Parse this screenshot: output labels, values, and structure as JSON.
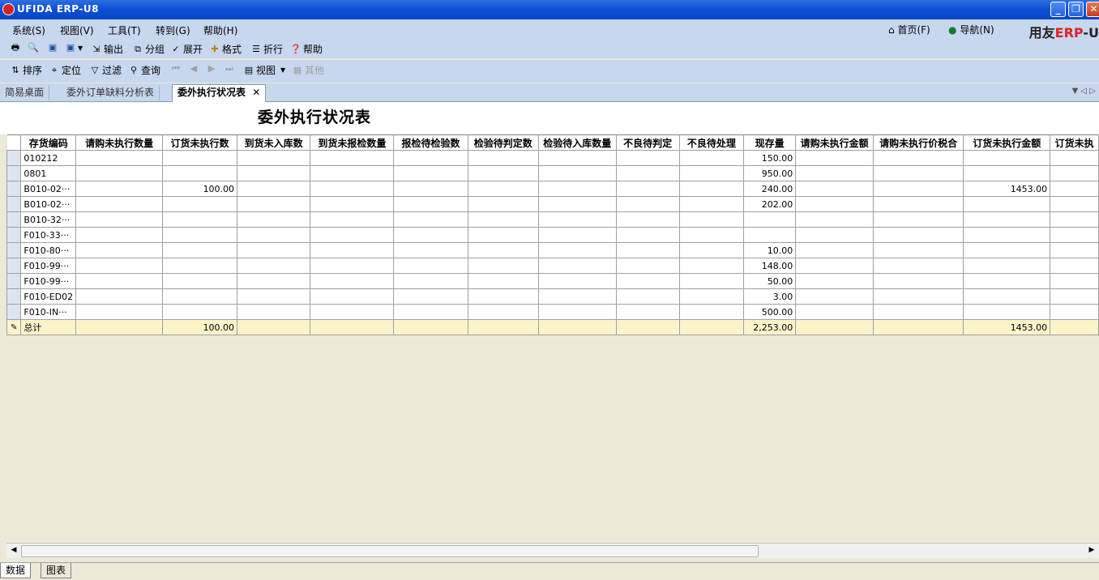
{
  "window": {
    "title": "UFIDA ERP-U8"
  },
  "menu": [
    "系统(S)",
    "视图(V)",
    "工具(T)",
    "转到(G)",
    "帮助(H)"
  ],
  "right_links": {
    "home": "首页(F)",
    "nav": "导航(N)",
    "brand_prefix": "用友",
    "brand_erp": "ERP",
    "brand_suffix": "-U"
  },
  "toolbar1": [
    {
      "label": "",
      "icon": "print-icon"
    },
    {
      "label": "",
      "icon": "preview-icon"
    },
    {
      "label": "",
      "icon": "save-icon"
    },
    {
      "label": "",
      "icon": "save-as-icon"
    },
    {
      "label": "输出",
      "icon": "export-icon"
    },
    {
      "label": "分组",
      "icon": "group-icon"
    },
    {
      "label": "展开",
      "icon": "expand-icon"
    },
    {
      "label": "格式",
      "icon": "format-icon"
    },
    {
      "label": "折行",
      "icon": "wrap-icon"
    },
    {
      "label": "帮助",
      "icon": "help-icon"
    }
  ],
  "toolbar2": [
    {
      "label": "排序",
      "icon": "sort-icon"
    },
    {
      "label": "定位",
      "icon": "locate-icon"
    },
    {
      "label": "过滤",
      "icon": "filter-icon"
    },
    {
      "label": "查询",
      "icon": "query-icon"
    },
    {
      "label": "视图",
      "icon": "view-icon"
    },
    {
      "label": "其他",
      "icon": "other-icon"
    }
  ],
  "tabs": [
    "简易桌面",
    "委外订单缺料分析表",
    "委外执行状况表"
  ],
  "report": {
    "title": "委外执行状况表",
    "columns": [
      "存货编码",
      "请购未执行数量",
      "订货未执行数",
      "到货未入库数",
      "到货未报检数量",
      "报检待检验数",
      "检验待判定数",
      "检验待入库数量",
      "不良待判定",
      "不良待处理",
      "现存量",
      "请购未执行金额",
      "请购未执行价税合",
      "订货未执行金额",
      "订货未执"
    ],
    "rows": [
      [
        "010212",
        "",
        "",
        "",
        "",
        "",
        "",
        "",
        "",
        "",
        "150.00",
        "",
        "",
        "",
        ""
      ],
      [
        "0801",
        "",
        "",
        "",
        "",
        "",
        "",
        "",
        "",
        "",
        "950.00",
        "",
        "",
        "",
        ""
      ],
      [
        "B010-02···",
        "",
        "100.00",
        "",
        "",
        "",
        "",
        "",
        "",
        "",
        "240.00",
        "",
        "",
        "1453.00",
        ""
      ],
      [
        "B010-02···",
        "",
        "",
        "",
        "",
        "",
        "",
        "",
        "",
        "",
        "202.00",
        "",
        "",
        "",
        ""
      ],
      [
        "B010-32···",
        "",
        "",
        "",
        "",
        "",
        "",
        "",
        "",
        "",
        "",
        "",
        "",
        "",
        ""
      ],
      [
        "F010-33···",
        "",
        "",
        "",
        "",
        "",
        "",
        "",
        "",
        "",
        "",
        "",
        "",
        "",
        ""
      ],
      [
        "F010-80···",
        "",
        "",
        "",
        "",
        "",
        "",
        "",
        "",
        "",
        "10.00",
        "",
        "",
        "",
        ""
      ],
      [
        "F010-99···",
        "",
        "",
        "",
        "",
        "",
        "",
        "",
        "",
        "",
        "148.00",
        "",
        "",
        "",
        ""
      ],
      [
        "F010-99···",
        "",
        "",
        "",
        "",
        "",
        "",
        "",
        "",
        "",
        "50.00",
        "",
        "",
        "",
        ""
      ],
      [
        "F010-ED02",
        "",
        "",
        "",
        "",
        "",
        "",
        "",
        "",
        "",
        "3.00",
        "",
        "",
        "",
        ""
      ],
      [
        "F010-IN···",
        "",
        "",
        "",
        "",
        "",
        "",
        "",
        "",
        "",
        "500.00",
        "",
        "",
        "",
        ""
      ]
    ],
    "total": [
      "总计",
      "",
      "100.00",
      "",
      "",
      "",
      "",
      "",
      "",
      "",
      "2,253.00",
      "",
      "",
      "1453.00",
      ""
    ]
  },
  "bottom_tabs": [
    "数据",
    "图表"
  ]
}
